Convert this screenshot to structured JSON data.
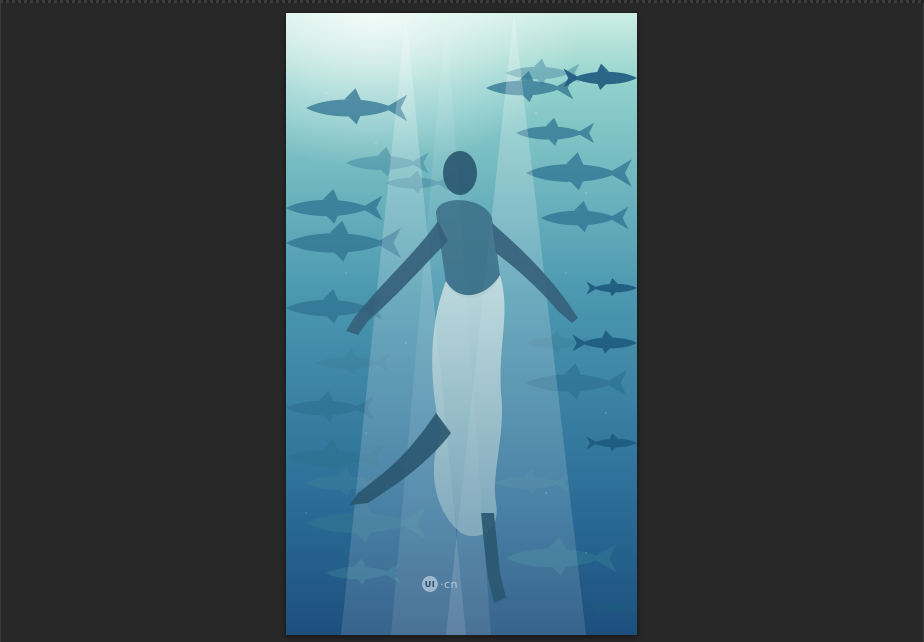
{
  "workspace": {
    "background_color": "#282828"
  },
  "artwork": {
    "subject": "underwater-diver-with-tuna",
    "colors": {
      "top": "#bfe6dc",
      "middle": "#3f8aa3",
      "bottom": "#1c4f7a",
      "fish": "#2a6a8c",
      "beam": "#ffffff"
    },
    "logo": {
      "mark": "UI",
      "text": "·cn"
    }
  }
}
